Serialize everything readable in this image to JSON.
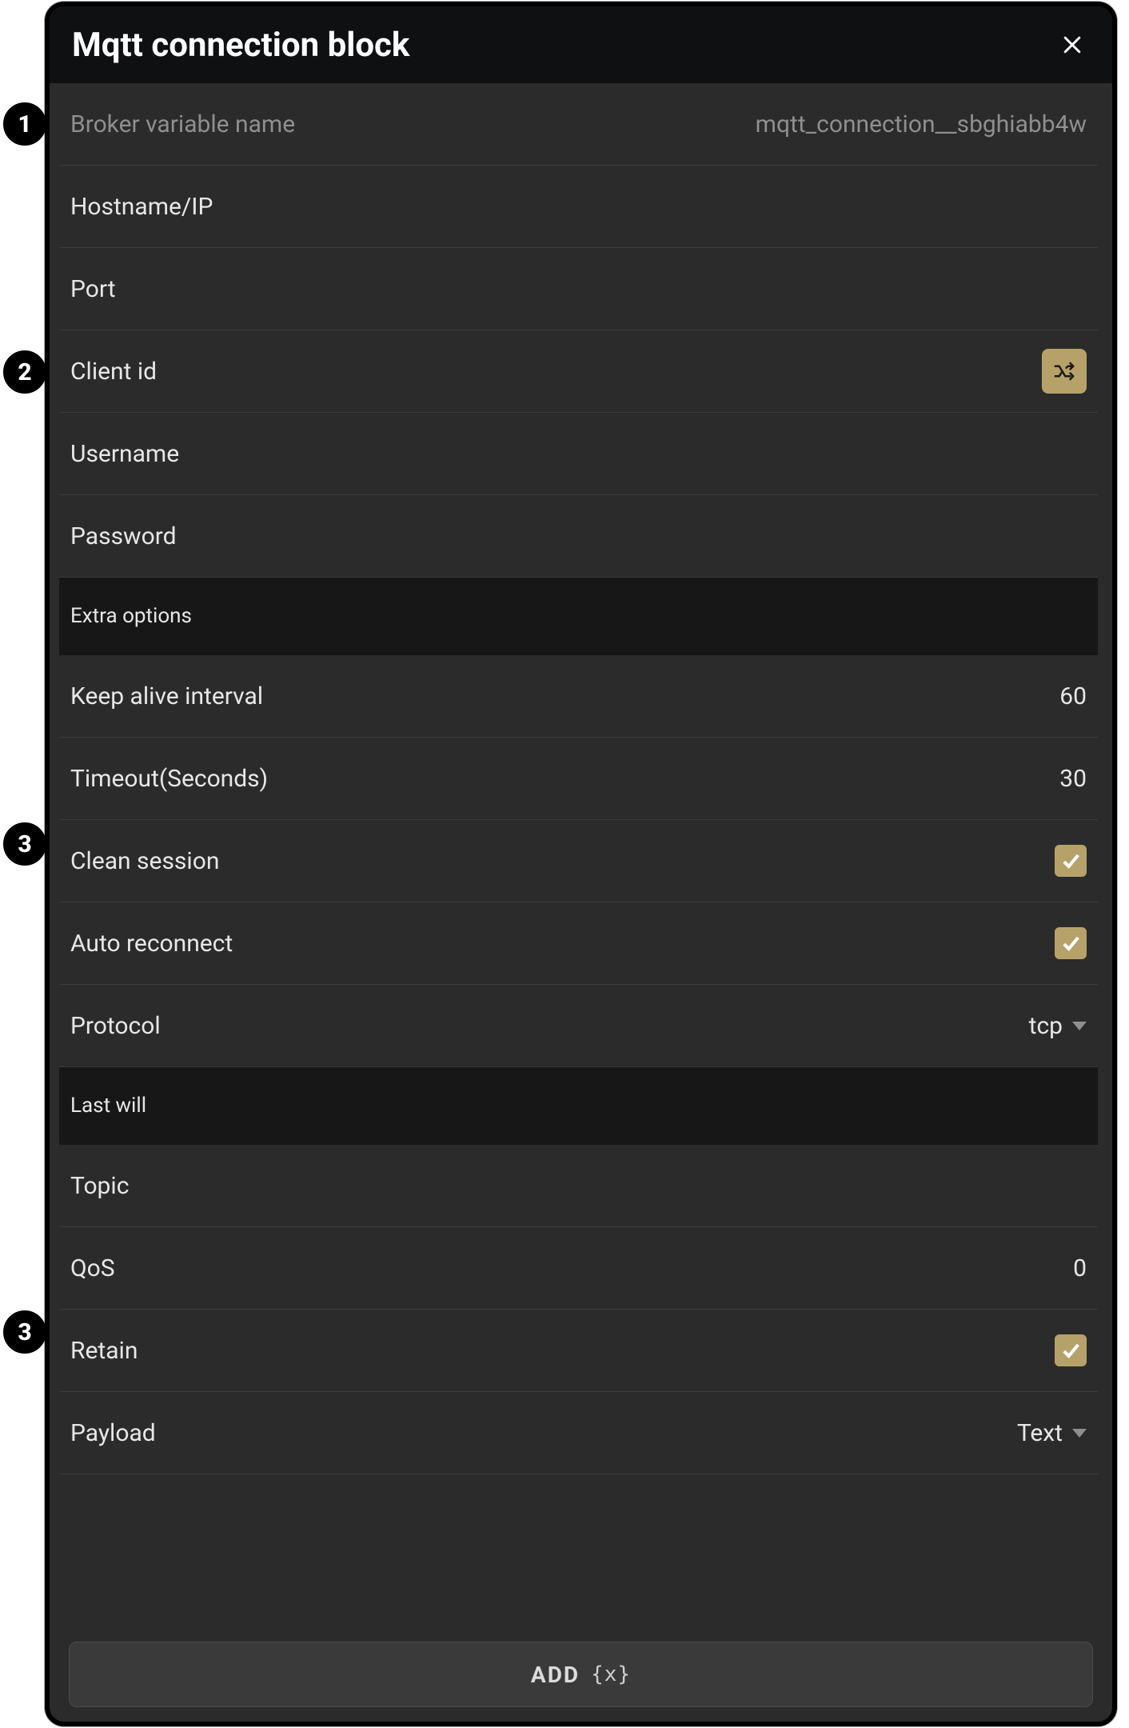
{
  "dialog": {
    "title": "Mqtt connection block",
    "badges": {
      "b1": "1",
      "b2": "2",
      "b3": "3",
      "b4": "3"
    }
  },
  "rows": {
    "broker_var_label": "Broker variable name",
    "broker_var_value": "mqtt_connection__sbghiabb4w",
    "hostname_label": "Hostname/IP",
    "port_label": "Port",
    "client_id_label": "Client id",
    "username_label": "Username",
    "password_label": "Password"
  },
  "sections": {
    "extra_options": "Extra options",
    "last_will": "Last will"
  },
  "extra": {
    "keep_alive_label": "Keep alive interval",
    "keep_alive_value": "60",
    "timeout_label": "Timeout(Seconds)",
    "timeout_value": "30",
    "clean_session_label": "Clean session",
    "auto_reconnect_label": "Auto reconnect",
    "protocol_label": "Protocol",
    "protocol_value": "tcp"
  },
  "lastwill": {
    "topic_label": "Topic",
    "qos_label": "QoS",
    "qos_value": "0",
    "retain_label": "Retain",
    "payload_label": "Payload",
    "payload_value": "Text"
  },
  "footer": {
    "add_label": "ADD",
    "add_code": "{x}"
  }
}
